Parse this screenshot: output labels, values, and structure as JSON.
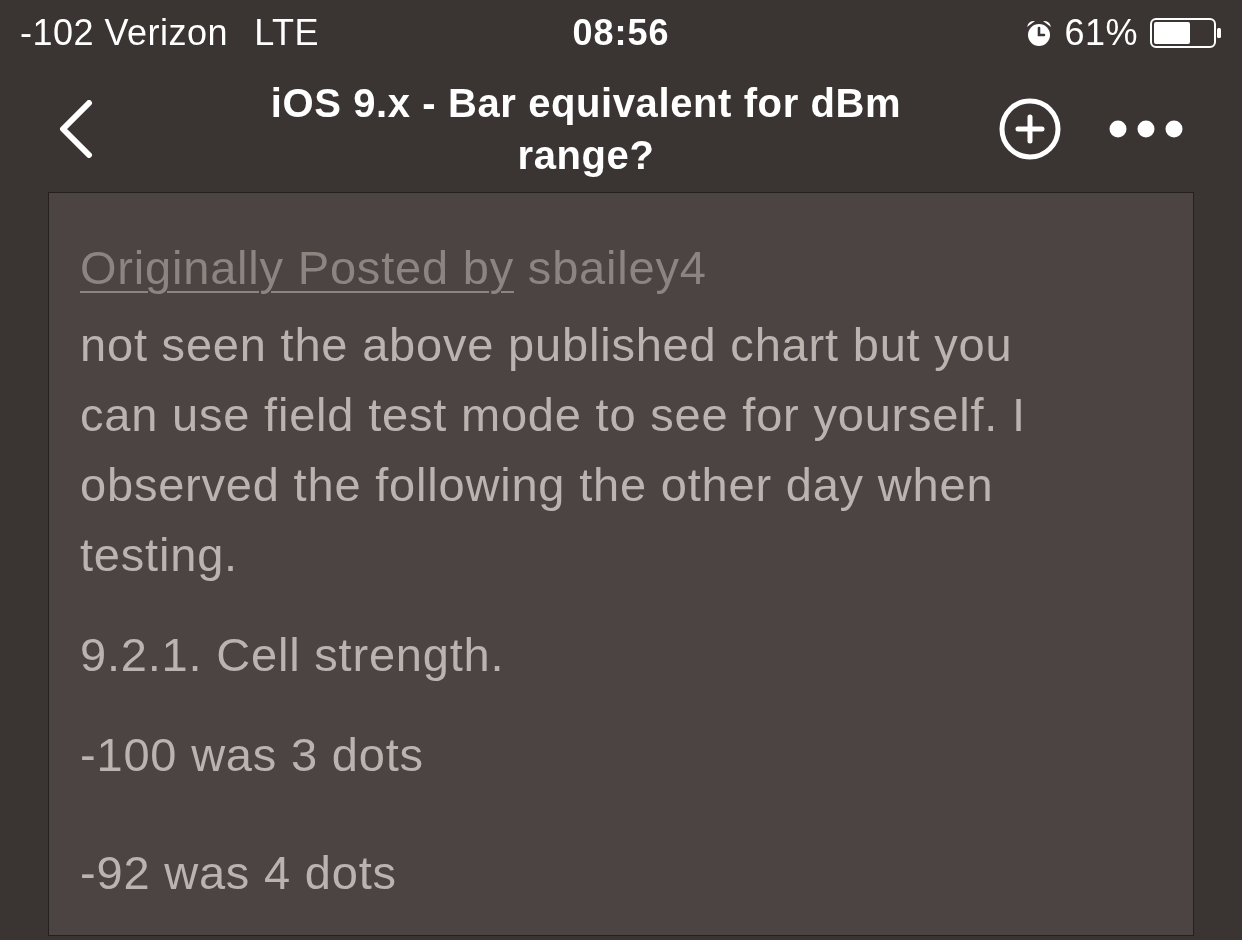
{
  "status_bar": {
    "carrier": "-102 Verizon",
    "network": "LTE",
    "time": "08:56",
    "battery_percent": "61%"
  },
  "nav_bar": {
    "title": "iOS 9.x - Bar equivalent for dBm range?"
  },
  "quote": {
    "attribution_link": "Originally Posted by",
    "author": "sbailey4",
    "paragraphs": [
      "not seen the above published chart but you can use field test mode to see for yourself. I observed the following the other day when testing.",
      "9.2.1. Cell strength.",
      "-100 was 3 dots",
      "-92 was 4 dots"
    ]
  }
}
